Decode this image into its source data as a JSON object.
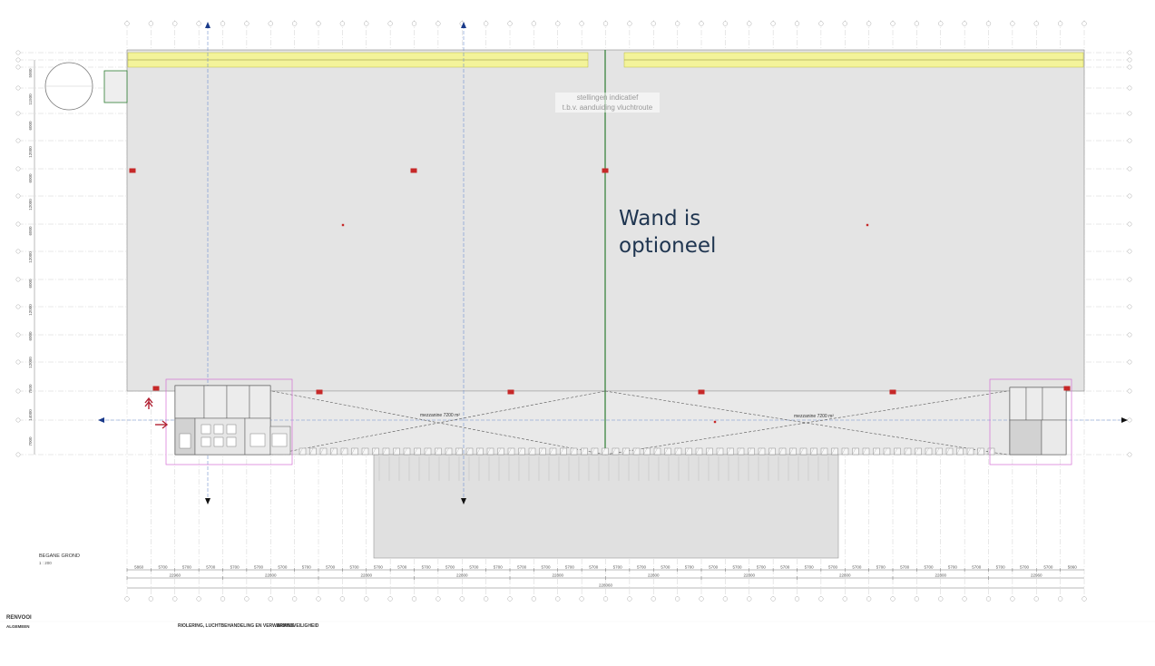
{
  "plan": {
    "floor_title": "BEGANE GROND",
    "floor_scale": "1 : 200",
    "note_wall_line1": "Wand is",
    "note_wall_line2": "optioneel",
    "stellingen_line1": "stellingen indicatief",
    "stellingen_line2": "t.b.v. aanduiding vluchtroute",
    "mezzanine_left": "mezzanine 7200 m²",
    "mezzanine_right": "mezzanine 7200 m²"
  },
  "dimensions": {
    "bay_row": [
      "5860",
      "5700",
      "5700",
      "5700",
      "5700",
      "5700",
      "5700",
      "5700",
      "5700",
      "5700",
      "5700",
      "5700",
      "5700",
      "5700",
      "5700",
      "5700",
      "5700",
      "5700",
      "5700",
      "5700",
      "5700",
      "5700",
      "5700",
      "5700",
      "5700",
      "5700",
      "5700",
      "5700",
      "5700",
      "5700",
      "5700",
      "5700",
      "5700",
      "5700",
      "5700",
      "5700",
      "5700",
      "5700",
      "5700",
      "5860"
    ],
    "group_row": [
      "22960",
      "22800",
      "22800",
      "22800",
      "22800",
      "22800",
      "22800",
      "22800",
      "22800",
      "22960"
    ],
    "total": "228060",
    "left_side": [
      "5000",
      "11500",
      "6000",
      "12000",
      "6000",
      "12000",
      "6000",
      "12000",
      "6000",
      "12000",
      "6000",
      "12000",
      "7500",
      "14000",
      "7000"
    ]
  },
  "legend": {
    "renvooi": "RENVOOI",
    "algemeen": "ALGEMEEN",
    "riolering": "RIOLERING, LUCHTBEHANDELING EN VERWARMING",
    "brandveiligheid": "BRANDVEILIGHEID"
  },
  "colors": {
    "hall": "#e4e4e4",
    "grid": "#b8b8b8",
    "yellow_band": "#f0f08a",
    "wall_green": "#2e7d32",
    "fire_red": "#c62828",
    "office_magenta": "#d36fd3",
    "note_navy": "#1f3550",
    "axis_blue": "#1a3a8a"
  }
}
